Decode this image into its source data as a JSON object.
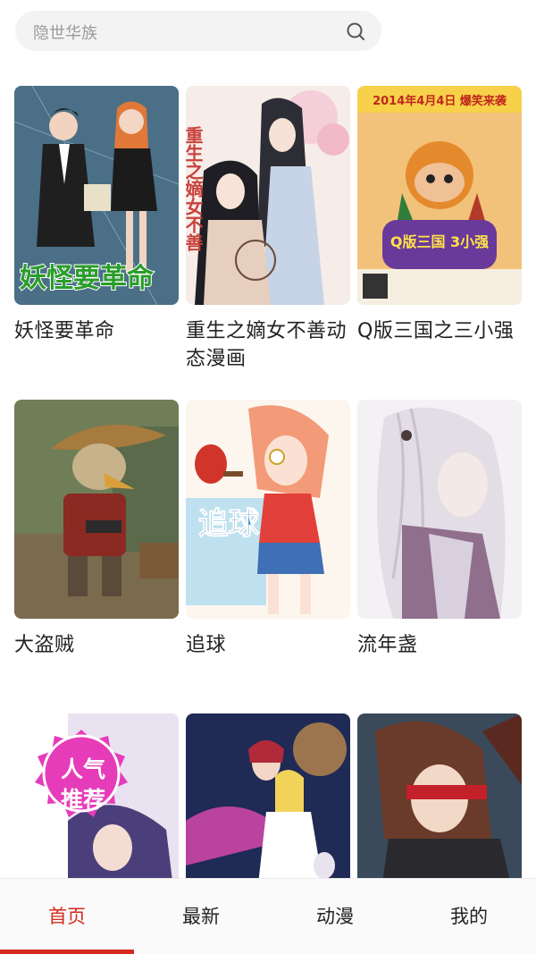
{
  "search": {
    "placeholder": "隐世华族"
  },
  "comics": [
    {
      "title": "妖怪要革命",
      "cover_text": "妖怪要革命"
    },
    {
      "title": "重生之嫡女不善动态漫画",
      "cover_text": "重生之嫡女不善"
    },
    {
      "title": "Q版三国之三小强",
      "cover_text": "2014年4月4日 爆笑来袭",
      "cover_logo": "Q版三国 3小强"
    },
    {
      "title": "大盗贼"
    },
    {
      "title": "追球",
      "cover_text": "追球"
    },
    {
      "title": "流年盏"
    },
    {
      "title": "",
      "badge": "人气推荐"
    },
    {
      "title": ""
    },
    {
      "title": ""
    }
  ],
  "tabbar": {
    "tabs": [
      {
        "label": "首页",
        "active": true
      },
      {
        "label": "最新",
        "active": false
      },
      {
        "label": "动漫",
        "active": false
      },
      {
        "label": "我的",
        "active": false
      }
    ],
    "accent_color": "#d52a1e"
  }
}
